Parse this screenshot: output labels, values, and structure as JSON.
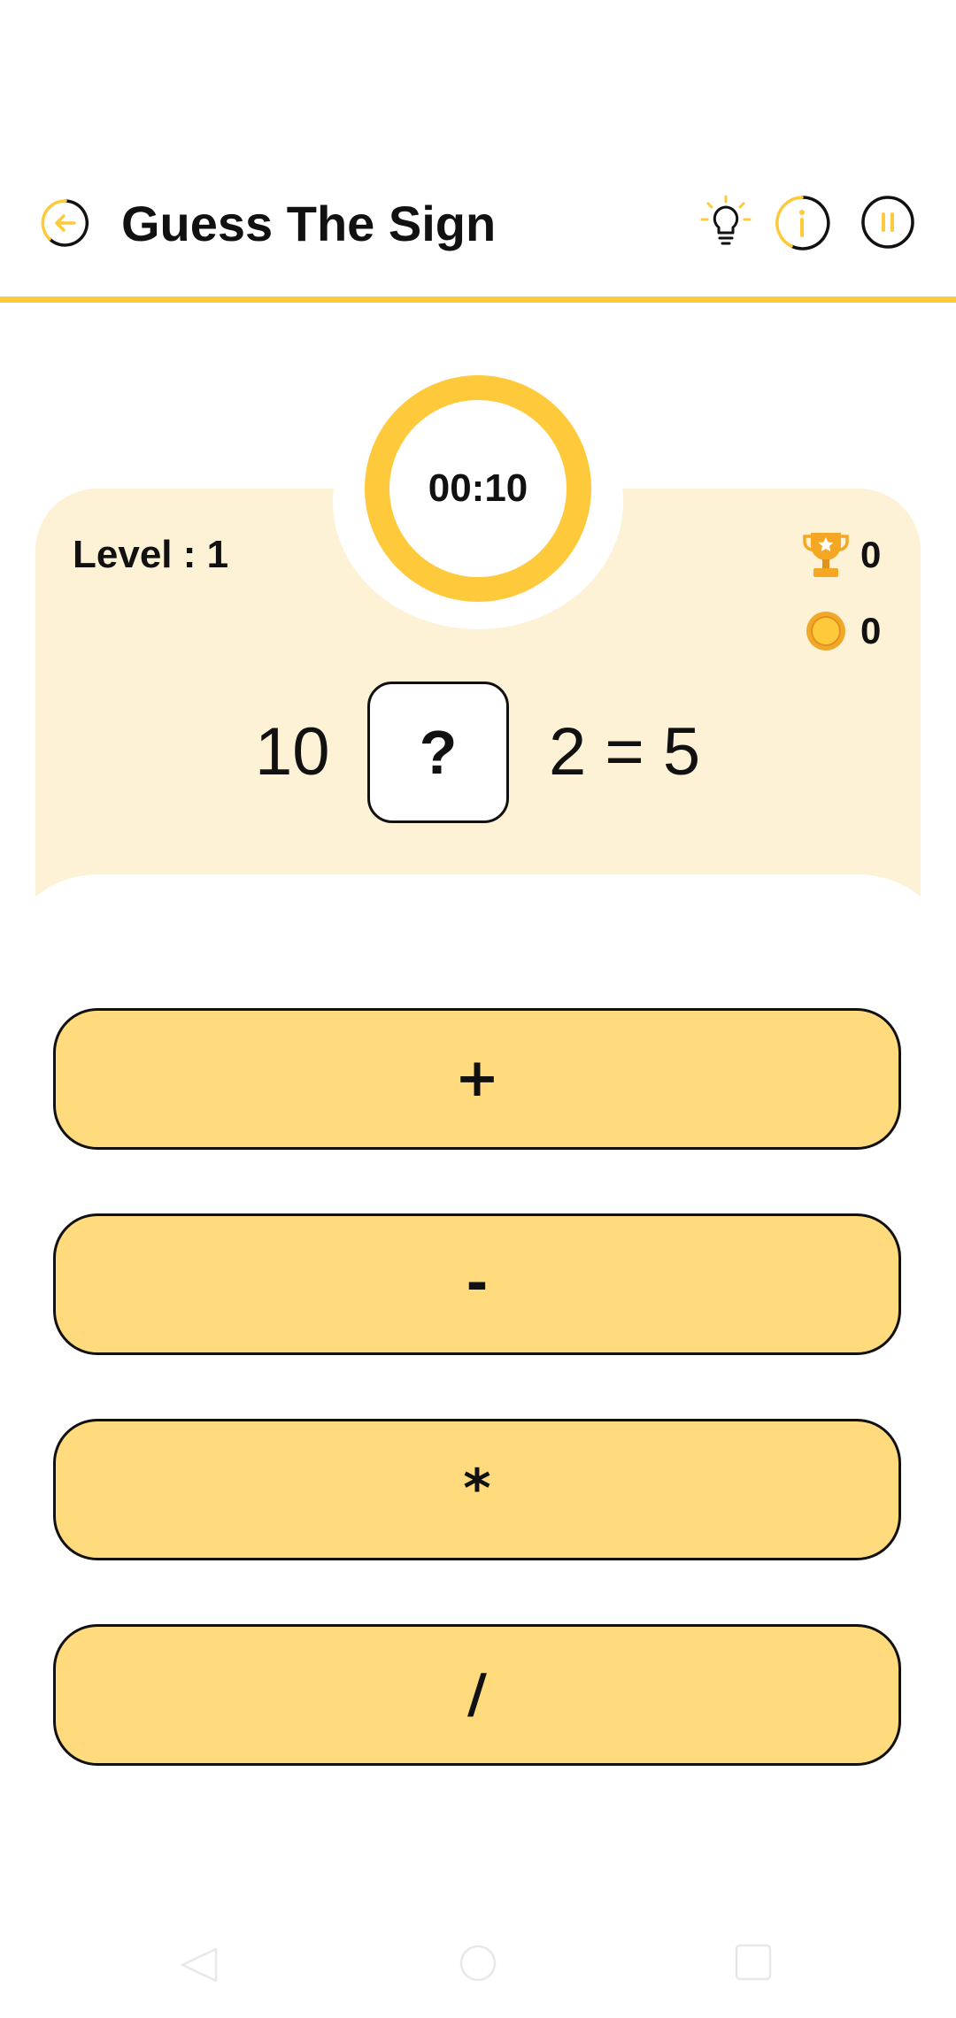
{
  "header": {
    "title": "Guess The Sign",
    "icons": {
      "back": "arrow-left-circle-icon",
      "hint": "lightbulb-icon",
      "info": "info-icon",
      "pause": "pause-icon"
    }
  },
  "game": {
    "timer": "00:10",
    "level": "Level : 1",
    "trophies": "0",
    "coins": "0",
    "equation": {
      "left": "10",
      "unknown": "?",
      "right": "2 = 5"
    }
  },
  "options": [
    "+",
    "-",
    "*",
    "/"
  ],
  "colors": {
    "accent": "#ffc93c",
    "card_bg": "#fdf2d6",
    "button_bg": "#ffdb7d",
    "text": "#111111"
  }
}
